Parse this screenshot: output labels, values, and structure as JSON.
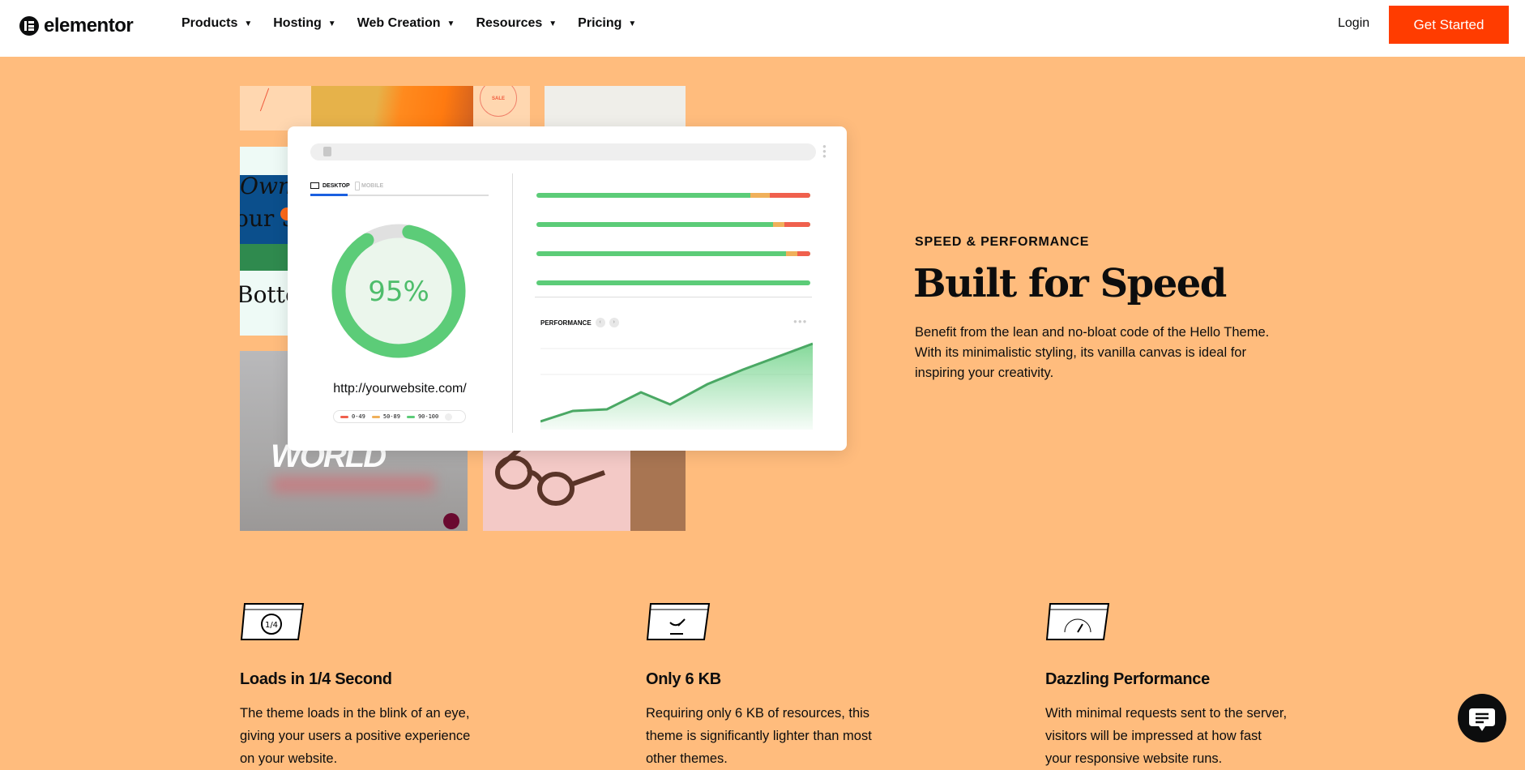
{
  "header": {
    "logo": "elementor",
    "nav": [
      {
        "label": "Products"
      },
      {
        "label": "Hosting"
      },
      {
        "label": "Web Creation"
      },
      {
        "label": "Resources"
      },
      {
        "label": "Pricing"
      }
    ],
    "login": "Login",
    "cta": "Get Started",
    "cta_color": "#FF3C00"
  },
  "mockup": {
    "tabs": {
      "desktop": "DESKTOP",
      "mobile": "MOBILE"
    },
    "score": "95%",
    "score_value": 95,
    "url": "http://yourwebsite.com/",
    "legend": [
      "0-49",
      "50-89",
      "90-100"
    ],
    "legend_colors": [
      "#f0604d",
      "#f0b05a",
      "#5ccc78"
    ],
    "performance_label": "PERFORMANCE",
    "collage": {
      "sale": "SALE",
      "world": "WORLD",
      "own": "Own",
      "your": "our S",
      "bottom": "Botto"
    }
  },
  "hero": {
    "eyebrow": "SPEED & PERFORMANCE",
    "title": "Built for Speed",
    "text": "Benefit from the lean and no-bloat code of the Hello Theme. With its minimalistic styling, its vanilla canvas is ideal for inspiring your creativity."
  },
  "features": [
    {
      "icon": "stopwatch-quarter-icon",
      "icon_text": "1/4",
      "title": "Loads in 1/4 Second",
      "text": "The theme loads in the blink of an eye, giving your users a positive experience on your website."
    },
    {
      "icon": "feather-scale-icon",
      "title": "Only 6 KB",
      "text": "Requiring only 6 KB of resources, this theme is significantly lighter than most other themes."
    },
    {
      "icon": "speedometer-icon",
      "title": "Dazzling Performance",
      "text": "With minimal requests sent to the server, visitors will be impressed at how fast your responsive website runs."
    }
  ],
  "background": "#FFBC7D"
}
